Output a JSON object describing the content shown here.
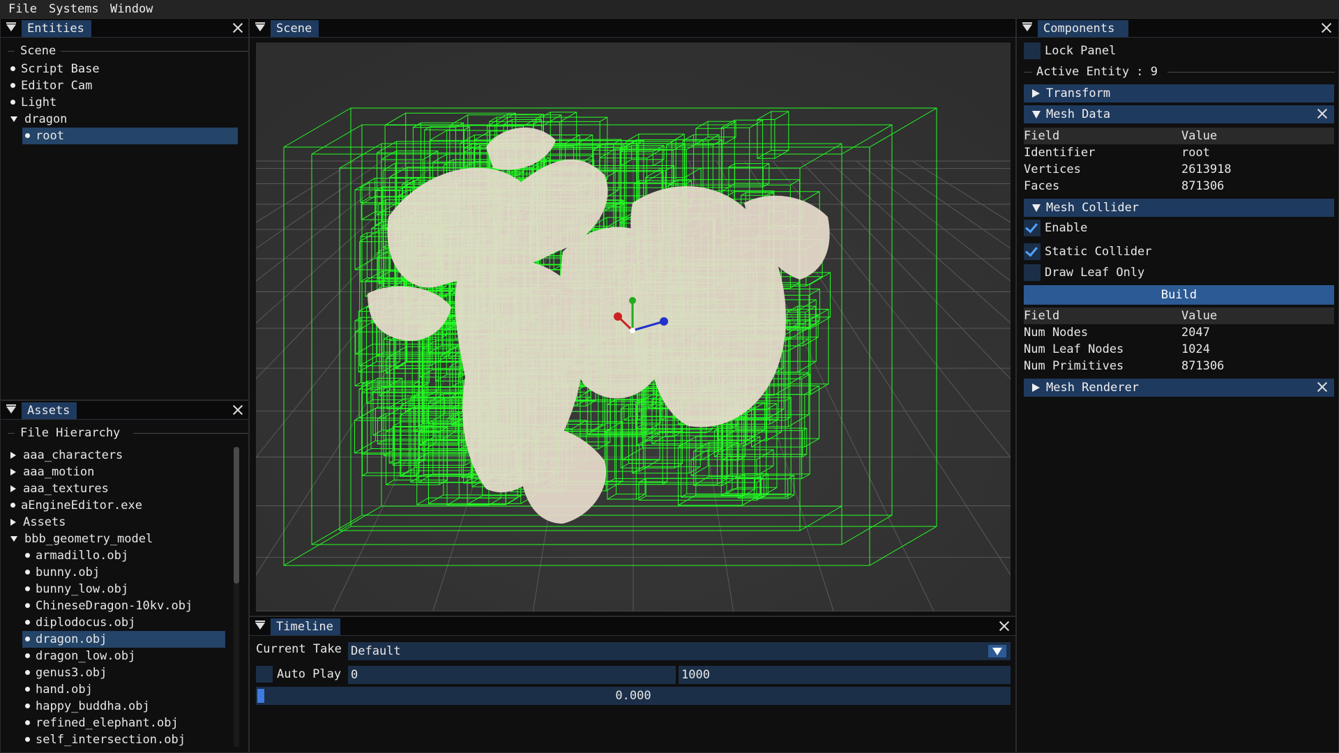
{
  "menu": [
    "File",
    "Systems",
    "Window"
  ],
  "entities": {
    "title": "Entities",
    "section": "Scene",
    "items": [
      {
        "label": "Script Base",
        "kind": "leaf",
        "depth": 0
      },
      {
        "label": "Editor Cam",
        "kind": "leaf",
        "depth": 0
      },
      {
        "label": "Light",
        "kind": "leaf",
        "depth": 0
      },
      {
        "label": "dragon",
        "kind": "open",
        "depth": 0
      },
      {
        "label": "root",
        "kind": "leaf",
        "depth": 1,
        "selected": true
      }
    ]
  },
  "assets": {
    "title": "Assets",
    "section": "File Hierarchy",
    "items": [
      {
        "label": "aaa_characters",
        "kind": "closed",
        "depth": 0
      },
      {
        "label": "aaa_motion",
        "kind": "closed",
        "depth": 0
      },
      {
        "label": "aaa_textures",
        "kind": "closed",
        "depth": 0
      },
      {
        "label": "aEngineEditor.exe",
        "kind": "leaf",
        "depth": 0
      },
      {
        "label": "Assets",
        "kind": "closed",
        "depth": 0
      },
      {
        "label": "bbb_geometry_model",
        "kind": "open",
        "depth": 0
      },
      {
        "label": "armadillo.obj",
        "kind": "leaf",
        "depth": 1
      },
      {
        "label": "bunny.obj",
        "kind": "leaf",
        "depth": 1
      },
      {
        "label": "bunny_low.obj",
        "kind": "leaf",
        "depth": 1
      },
      {
        "label": "ChineseDragon-10kv.obj",
        "kind": "leaf",
        "depth": 1
      },
      {
        "label": "diplodocus.obj",
        "kind": "leaf",
        "depth": 1
      },
      {
        "label": "dragon.obj",
        "kind": "leaf",
        "depth": 1,
        "selected": true
      },
      {
        "label": "dragon_low.obj",
        "kind": "leaf",
        "depth": 1
      },
      {
        "label": "genus3.obj",
        "kind": "leaf",
        "depth": 1
      },
      {
        "label": "hand.obj",
        "kind": "leaf",
        "depth": 1
      },
      {
        "label": "happy_buddha.obj",
        "kind": "leaf",
        "depth": 1
      },
      {
        "label": "refined_elephant.obj",
        "kind": "leaf",
        "depth": 1
      },
      {
        "label": "self_intersection.obj",
        "kind": "leaf",
        "depth": 1
      }
    ]
  },
  "scene": {
    "title": "Scene"
  },
  "timeline": {
    "title": "Timeline",
    "take_label": "Current Take",
    "take_value": "Default",
    "autoplay_label": "Auto Play",
    "start": "0",
    "end": "1000",
    "time": "0.000",
    "progress": 0.0
  },
  "components": {
    "title": "Components",
    "lock_panel": "Lock Panel",
    "active_entity": "Active Entity : 9",
    "transform": "Transform",
    "mesh_data": {
      "title": "Mesh Data",
      "field_header": "Field",
      "value_header": "Value",
      "rows": [
        {
          "field": "Identifier",
          "value": "root"
        },
        {
          "field": "Vertices",
          "value": "2613918"
        },
        {
          "field": "Faces",
          "value": "871306"
        }
      ]
    },
    "mesh_collider": {
      "title": "Mesh Collider",
      "enable": "Enable",
      "enable_checked": true,
      "static": "Static Collider",
      "static_checked": true,
      "leaf_only": "Draw Leaf Only",
      "leaf_only_checked": false,
      "build": "Build",
      "field_header": "Field",
      "value_header": "Value",
      "rows": [
        {
          "field": "Num Nodes",
          "value": "2047"
        },
        {
          "field": "Num Leaf Nodes",
          "value": "1024"
        },
        {
          "field": "Num Primitives",
          "value": "871306"
        }
      ]
    },
    "mesh_renderer": "Mesh Renderer"
  },
  "colors": {
    "accent": "#1f3a5f",
    "bvh_green": "#22ff22",
    "mesh": "#e8dccd"
  }
}
